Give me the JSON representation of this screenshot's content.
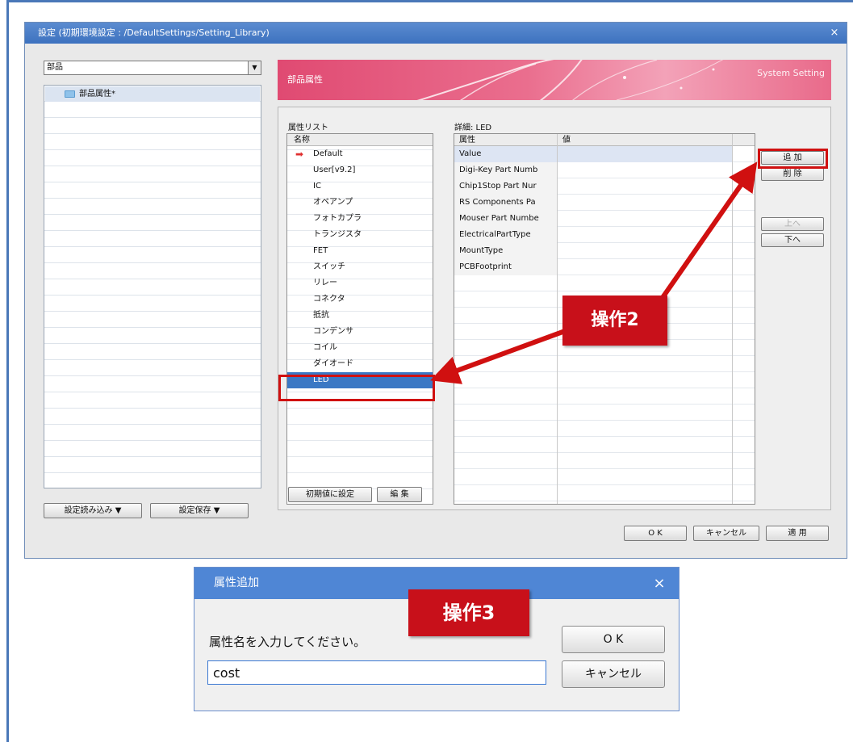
{
  "main_window": {
    "title": "設定 (初期環境設定 : /DefaultSettings/Setting_Library)",
    "close_glyph": "×",
    "category_select": {
      "value": "部品",
      "arrow": "▼"
    },
    "tree": {
      "items": [
        {
          "label": "部品属性*"
        }
      ]
    },
    "left_buttons": {
      "load": "設定読み込み ▼",
      "save": "設定保存 ▼"
    },
    "banner": {
      "title": "部品属性",
      "right_text": "System Setting"
    },
    "attribute_list": {
      "label": "属性リスト",
      "header": "名称",
      "items": [
        {
          "label": "Default"
        },
        {
          "label": "User[v9.2]"
        },
        {
          "label": "IC"
        },
        {
          "label": "オペアンプ"
        },
        {
          "label": "フォトカプラ"
        },
        {
          "label": "トランジスタ"
        },
        {
          "label": "FET"
        },
        {
          "label": "スイッチ"
        },
        {
          "label": "リレー"
        },
        {
          "label": "コネクタ"
        },
        {
          "label": "抵抗"
        },
        {
          "label": "コンデンサ"
        },
        {
          "label": "コイル"
        },
        {
          "label": "ダイオード"
        },
        {
          "label": "LED"
        }
      ],
      "selected_index": 14,
      "default_marker": "➡"
    },
    "detail": {
      "label": "詳細: LED",
      "col_attr": "属性",
      "col_value": "値",
      "rows": [
        {
          "name": "Value",
          "value": ""
        },
        {
          "name": "Digi-Key Part Numb",
          "value": ""
        },
        {
          "name": "Chip1Stop Part Nur",
          "value": ""
        },
        {
          "name": "RS Components Pa",
          "value": ""
        },
        {
          "name": "Mouser Part Numbe",
          "value": ""
        },
        {
          "name": "ElectricalPartType",
          "value": ""
        },
        {
          "name": "MountType",
          "value": ""
        },
        {
          "name": "PCBFootprint",
          "value": ""
        }
      ]
    },
    "side_buttons": {
      "add": "追 加",
      "delete": "削 除",
      "up": "上へ",
      "down": "下へ"
    },
    "list_buttons": {
      "reset": "初期値に設定",
      "edit": "編 集"
    },
    "footer_buttons": {
      "ok": "O K",
      "cancel": "キャンセル",
      "apply": "適 用"
    }
  },
  "callouts": {
    "step2": "操作2",
    "step3": "操作3"
  },
  "dialog": {
    "title": "属性追加",
    "close_glyph": "×",
    "prompt": "属性名を入力してください。",
    "input_value": "cost",
    "ok": "O K",
    "cancel": "キャンセル"
  },
  "colors": {
    "accent_red": "#d01010",
    "title_blue": "#4f86d5",
    "selection_blue": "#3b78c4",
    "banner_pink": "#e04a72"
  }
}
